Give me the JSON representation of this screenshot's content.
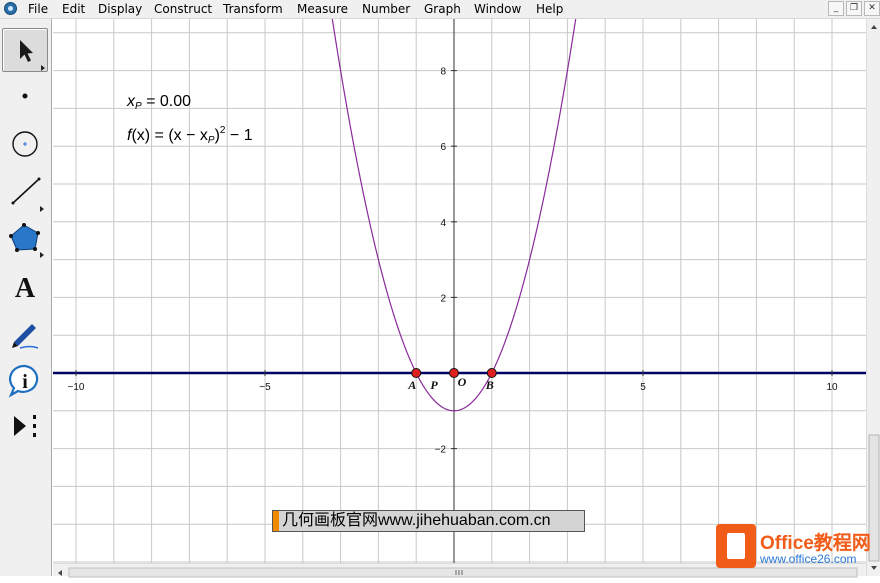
{
  "menu": [
    "File",
    "Edit",
    "Display",
    "Construct",
    "Transform",
    "Measure",
    "Number",
    "Graph",
    "Window",
    "Help"
  ],
  "window_controls": {
    "minimize": "_",
    "restore": "❐",
    "close": "✕"
  },
  "tools": [
    {
      "name": "selection-arrow-tool",
      "icon": "arrow-icon",
      "selected": true
    },
    {
      "name": "point-tool",
      "icon": "point-icon"
    },
    {
      "name": "compass-tool",
      "icon": "compass-icon"
    },
    {
      "name": "straightedge-tool",
      "icon": "line-icon"
    },
    {
      "name": "polygon-tool",
      "icon": "polygon-icon"
    },
    {
      "name": "text-tool",
      "icon": "text-icon",
      "label": "A"
    },
    {
      "name": "marker-tool",
      "icon": "marker-icon"
    },
    {
      "name": "information-tool",
      "icon": "info-icon",
      "label": "i"
    },
    {
      "name": "custom-tool",
      "icon": "custom-tools-icon"
    }
  ],
  "measurements": {
    "xp_var": "x",
    "xp_sub": "P",
    "xp_rest": " = 0.00",
    "fx_left": "f",
    "fx_mid": "(x) = (x − x",
    "fx_sub": "P",
    "fx_close": ")",
    "fx_exp": "2",
    "fx_tail": " − 1"
  },
  "caption": "几何画板官网www.jihehuaban.com.cn",
  "watermark": {
    "brand": "Office教程网",
    "url": "www.office26.com"
  },
  "colors": {
    "axis": "#000066",
    "curve": "#8a2a9a",
    "grid": "#c8c8c8",
    "point_fill": "#e02020"
  },
  "chart_data": {
    "type": "line",
    "x_ticks": [
      -10,
      -5,
      5,
      10
    ],
    "y_ticks": [
      -2,
      2,
      4,
      6,
      8
    ],
    "xlim": [
      -10.5,
      10.9
    ],
    "ylim": [
      -5,
      9.6
    ],
    "grid": true,
    "function": "f(x) = (x - xP)^2 - 1",
    "xP": 0,
    "points": [
      {
        "label": "A",
        "x": -1,
        "y": 0
      },
      {
        "label": "O",
        "x": 0,
        "y": 0
      },
      {
        "label": "B",
        "x": 1,
        "y": 0
      },
      {
        "label": "P",
        "x": 0,
        "y": 0
      }
    ]
  }
}
